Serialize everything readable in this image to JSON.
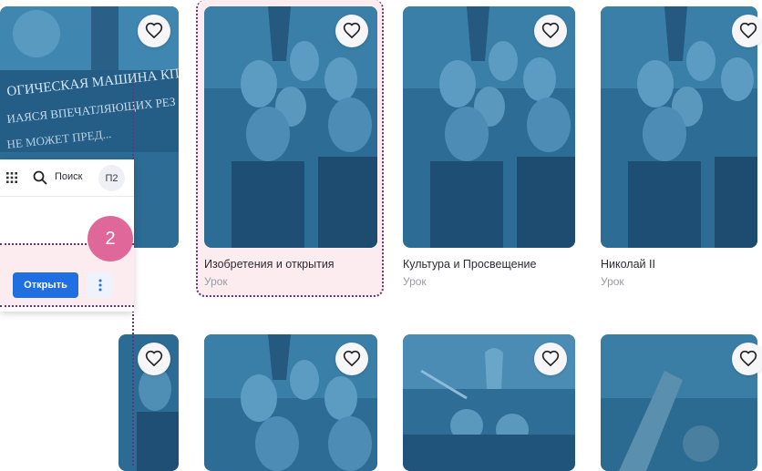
{
  "colors": {
    "card_tint": "#2f6f96",
    "highlight_bg": "#fdecef",
    "dotted_outline": "#5a3a7a",
    "primary_button": "#1f6fe0",
    "step_badge": "#e0679a"
  },
  "cards": [
    {
      "title": "",
      "type": "",
      "image": "soviet-slogan-banner",
      "banner_line1": "ОГИЧЕСКАЯ МАШИНА КПСС",
      "banner_line2": "ИАЯСЯ ВПЕЧАТЛЯЮЩИХ РЕЗ",
      "banner_line3": "НЕ МОЖЕТ ПРЕД..."
    },
    {
      "title": "Изобретения и открытия",
      "type": "Урок",
      "image": "russian-rulers-collage"
    },
    {
      "title": "Культура и Просвещение",
      "type": "Урок",
      "image": "russian-rulers-collage"
    },
    {
      "title": "Николай II",
      "type": "Урок",
      "image": "russian-rulers-collage"
    },
    {
      "title": "",
      "type": "",
      "image": "warriors-battle"
    },
    {
      "title": "",
      "type": "",
      "image": "russian-rulers-collage"
    },
    {
      "title": "",
      "type": "",
      "image": "viking-ship-battle"
    },
    {
      "title": "",
      "type": "",
      "image": "war-machinery"
    }
  ],
  "popup": {
    "search_label": "Поиск",
    "avatar_initials": "П2",
    "open_button_label": "Открыть",
    "step_number": "2"
  },
  "icons": {
    "favorite": "heart-outline-icon",
    "apps": "grid-icon",
    "search": "search-icon",
    "more": "vertical-dots-icon"
  }
}
